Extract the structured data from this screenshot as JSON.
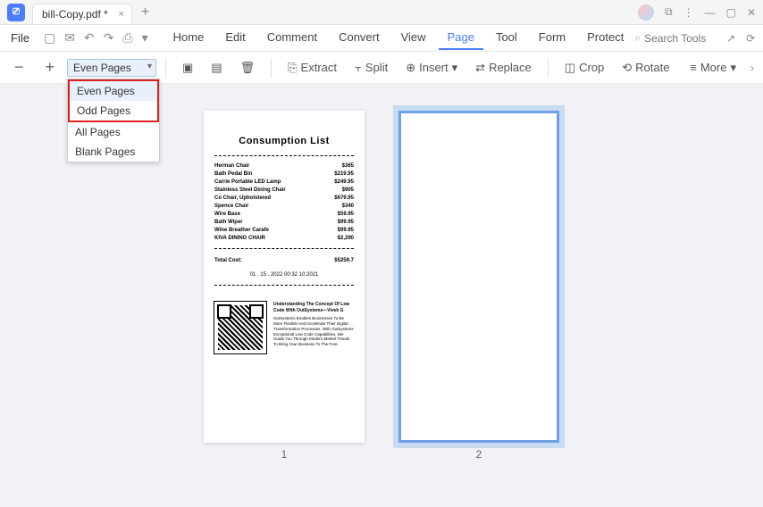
{
  "titlebar": {
    "tab_title": "bill-Copy.pdf *"
  },
  "menubar": {
    "file_label": "File",
    "tabs": [
      "Home",
      "Edit",
      "Comment",
      "Convert",
      "View",
      "Page",
      "Tool",
      "Form",
      "Protect"
    ],
    "active_tab_index": 5,
    "search_placeholder": "Search Tools"
  },
  "toolbar": {
    "dropdown_selected": "Even Pages",
    "dropdown_items": [
      "Even Pages",
      "Odd Pages",
      "All Pages",
      "Blank Pages"
    ],
    "extract": "Extract",
    "split": "Split",
    "insert": "Insert",
    "replace": "Replace",
    "crop": "Crop",
    "rotate": "Rotate",
    "more": "More"
  },
  "pages": {
    "p1": "1",
    "p2": "2"
  },
  "document": {
    "title": "Consumption List",
    "items": [
      {
        "name": "Herman Chair",
        "price": "$365"
      },
      {
        "name": "Bath Pedal Bin",
        "price": "$219.95"
      },
      {
        "name": "Carrie Portable LED Lamp",
        "price": "$249.95"
      },
      {
        "name": "Stainless Steel Dining Chair",
        "price": "$905"
      },
      {
        "name": "Co Chair, Upholstered",
        "price": "$679.95"
      },
      {
        "name": "Spence Chair",
        "price": "$340"
      },
      {
        "name": "Wire Base",
        "price": "$59.95"
      },
      {
        "name": "Bath Wiper",
        "price": "$99.95"
      },
      {
        "name": "Wine Breather Carafe",
        "price": "$99.95"
      },
      {
        "name": "KIVA DINING CHAIR",
        "price": "$2,290"
      }
    ],
    "total_label": "Total Cost:",
    "total_value": "$5259.7",
    "date": "01 . 15 . 2022   00:32  10:2021",
    "article_title": "Understanding The Concept Of Low Code With OutSystems—Vivek G",
    "article_body": "OutSystems Enables Businesses To Be More Flexible And Accelerate Their Digital Transformation Processes. With OutSystems Exceptional Low Code Capabilities, We Guide You Through Modern Market Trends To Bring Your Business To The Fore."
  }
}
